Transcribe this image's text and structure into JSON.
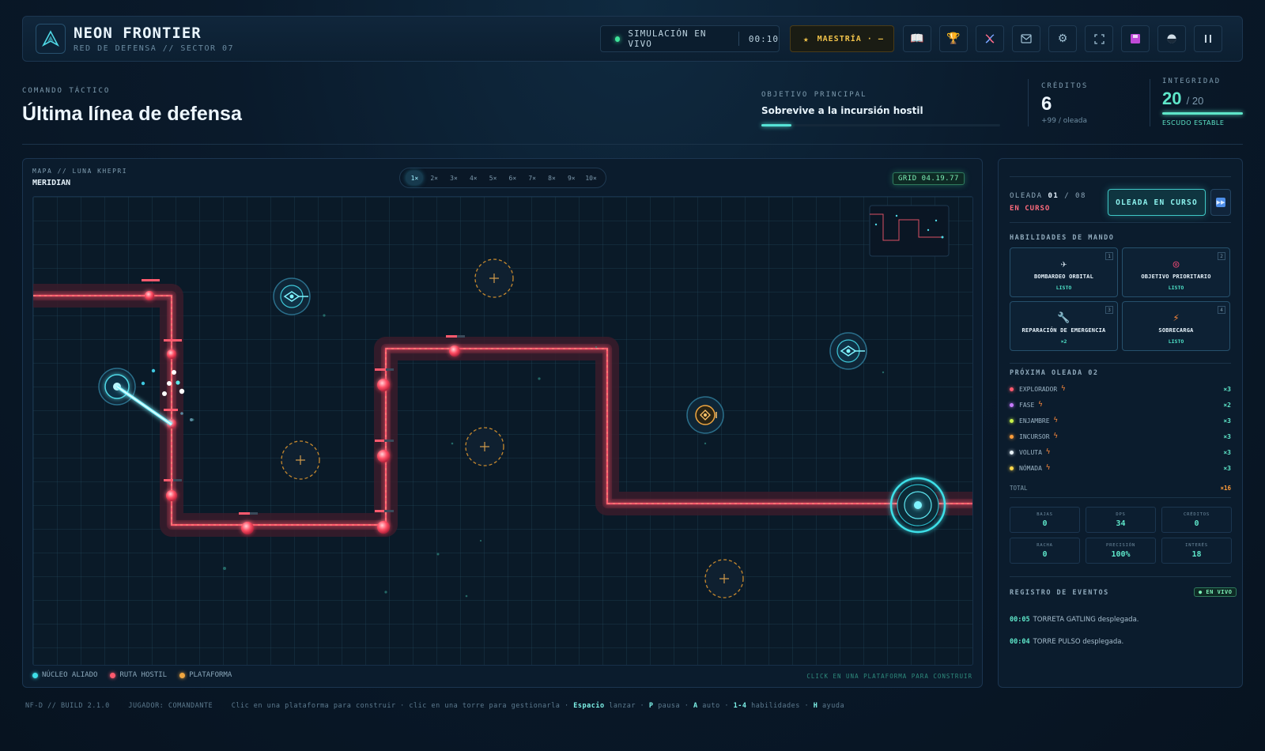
{
  "app": {
    "title": "NEON FRONTIER",
    "subtitle": "RED DE DEFENSA // SECTOR 07"
  },
  "topbar": {
    "live_label": "SIMULACIÓN EN VIVO",
    "timer": "00:10",
    "mastery_label": "MAESTRÍA · —",
    "icons": [
      "book-icon",
      "trophy-icon",
      "dna-icon",
      "mail-icon",
      "gear-icon",
      "fullscreen-icon",
      "save-icon",
      "contrast-icon",
      "pause-icon"
    ]
  },
  "header": {
    "eyebrow": "COMANDO TÁCTICO",
    "title": "Última línea de defensa",
    "objective_label": "OBJETIVO PRINCIPAL",
    "objective_value": "Sobrevive a la incursión hostil",
    "objective_progress": 0.125,
    "credits_label": "CRÉDITOS",
    "credits_value": "6",
    "credits_sub": "+99 / oleada",
    "integrity_label": "INTEGRIDAD",
    "integrity_value": "20",
    "integrity_max": "/ 20",
    "integrity_fraction": 1.0,
    "integrity_status": "ESCUDO ESTABLE"
  },
  "map": {
    "eyebrow": "MAPA // LUNA KHEPRI",
    "name": "MERIDIAN",
    "speeds": [
      "1×",
      "2×",
      "3×",
      "4×",
      "5×",
      "6×",
      "7×",
      "8×",
      "9×",
      "10×"
    ],
    "active_speed": "1×",
    "grid_badge": "GRID 04.19.77",
    "legend": [
      {
        "label": "NÚCLEO ALIADO",
        "color": "#3ee0e8"
      },
      {
        "label": "RUTA HOSTIL",
        "color": "#ff5a6e"
      },
      {
        "label": "PLATAFORMA",
        "color": "#f0a640"
      }
    ],
    "hint": "CLICK EN UNA PLATAFORMA PARA CONSTRUIR"
  },
  "side": {
    "wave_label": "OLEADA",
    "wave_current": "01",
    "wave_total": "/ 08",
    "wave_status": "EN CURSO",
    "wave_button": "OLEADA EN CURSO",
    "abilities_title": "HABILIDADES DE MANDO",
    "abilities": [
      {
        "key": "1",
        "name": "BOMBARDEO ORBITAL",
        "status": "LISTO",
        "icon": "satellite-icon",
        "glyph": "✈",
        "color": "#c8d7e2"
      },
      {
        "key": "2",
        "name": "OBJETIVO PRIORITARIO",
        "status": "LISTO",
        "icon": "target-icon",
        "glyph": "◎",
        "color": "#ff4d7a"
      },
      {
        "key": "3",
        "name": "REPARACIÓN DE EMERGENCIA",
        "status": "×2",
        "icon": "wrench-icon",
        "glyph": "🔧",
        "color": "#c8d7e2"
      },
      {
        "key": "4",
        "name": "SOBRECARGA",
        "status": "LISTO",
        "icon": "lightning-icon",
        "glyph": "⚡",
        "color": "#ff8a3c"
      }
    ],
    "next_wave_title": "PRÓXIMA OLEADA 02",
    "enemies": [
      {
        "name": "EXPLORADOR",
        "count": "×3",
        "color": "#ff5a6e"
      },
      {
        "name": "FASE",
        "count": "×2",
        "color": "#c77bff"
      },
      {
        "name": "ENJAMBRE",
        "count": "×3",
        "color": "#c6f04a"
      },
      {
        "name": "INCURSOR",
        "count": "×3",
        "color": "#ff9d3a"
      },
      {
        "name": "VOLUTA",
        "count": "×3",
        "color": "#e8f2f8"
      },
      {
        "name": "NÓMADA",
        "count": "×3",
        "color": "#ffd84a"
      }
    ],
    "total_label": "TOTAL",
    "total_value": "×16",
    "stats": [
      {
        "label": "BAJAS",
        "value": "0"
      },
      {
        "label": "DPS",
        "value": "34"
      },
      {
        "label": "CRÉDITOS",
        "value": "0"
      },
      {
        "label": "RACHA",
        "value": "0"
      },
      {
        "label": "PRECISIÓN",
        "value": "100%"
      },
      {
        "label": "INTERÉS",
        "value": "18"
      }
    ],
    "log_title": "REGISTRO DE EVENTOS",
    "log_badge": "● EN VIVO",
    "log": [
      {
        "time": "00:05",
        "text": "TORRETA GATLING desplegada."
      },
      {
        "time": "00:04",
        "text": "TORRE PULSO desplegada."
      }
    ]
  },
  "footer": {
    "build": "NF-D // BUILD 2.1.0",
    "player": "JUGADOR: COMANDANTE",
    "hint_a": "Clic en una plataforma para construir · clic en una torre para gestionarla ·",
    "k_space": "Espacio",
    "t_space": "lanzar ·",
    "k_p": "P",
    "t_p": "pausa ·",
    "k_a": "A",
    "t_a": "auto ·",
    "k_14": "1-4",
    "t_14": "habilidades ·",
    "k_h": "H",
    "t_h": "ayuda"
  }
}
